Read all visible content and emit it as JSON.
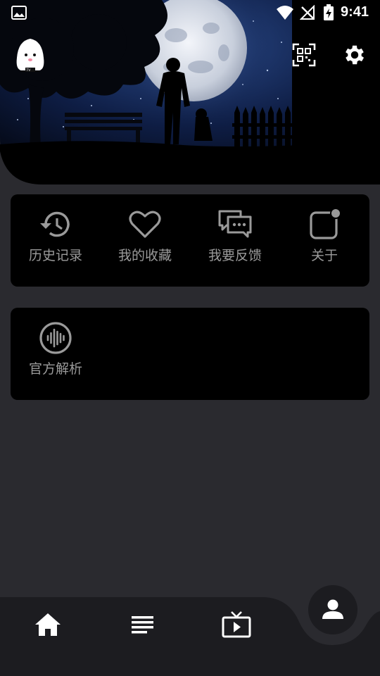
{
  "status_bar": {
    "time": "9:41",
    "icons": [
      "gallery-icon",
      "wifi-icon",
      "no-signal-icon",
      "battery-charging-icon"
    ]
  },
  "header": {
    "avatar_icon": "ghost-avatar-icon",
    "actions": [
      {
        "icon": "qr-scan-icon"
      },
      {
        "icon": "gear-icon"
      }
    ]
  },
  "menu_card": {
    "items": [
      {
        "label": "历史记录",
        "icon": "history-icon"
      },
      {
        "label": "我的收藏",
        "icon": "heart-icon"
      },
      {
        "label": "我要反馈",
        "icon": "feedback-chat-icon"
      },
      {
        "label": "关于",
        "icon": "about-badge-icon"
      }
    ]
  },
  "tools_card": {
    "items": [
      {
        "label": "官方解析",
        "icon": "audio-wave-icon"
      }
    ]
  },
  "bottom_nav": {
    "items": [
      {
        "icon": "home-icon"
      },
      {
        "icon": "list-icon"
      },
      {
        "icon": "tv-icon"
      },
      {
        "icon": "person-icon",
        "active": true
      }
    ]
  },
  "colors": {
    "background": "#2a2a2f",
    "card": "#000000",
    "label": "#9a9a9a",
    "nav_bar": "#1c1c20"
  }
}
